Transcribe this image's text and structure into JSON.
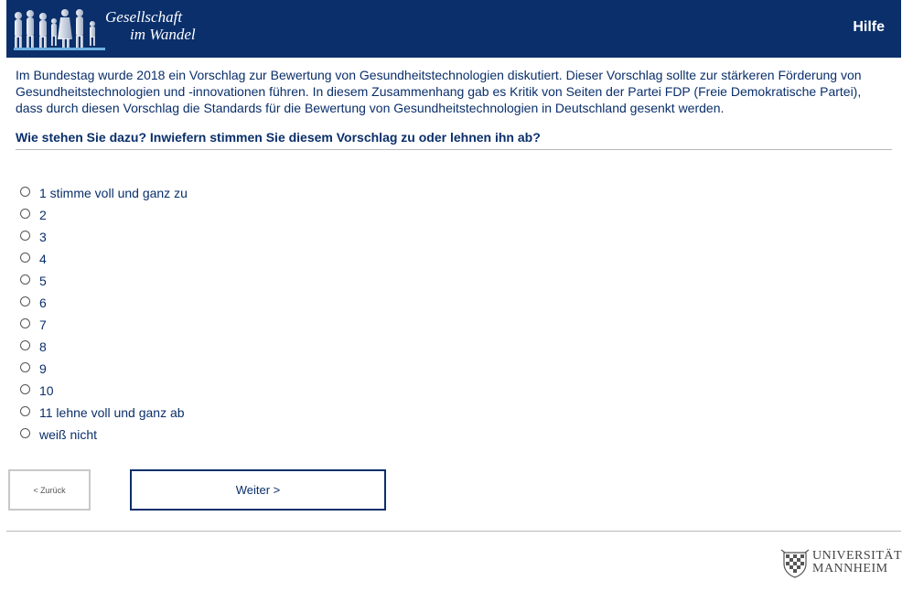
{
  "header": {
    "logo_line1": "Gesellschaft",
    "logo_line2": "im Wandel",
    "help_label": "Hilfe",
    "background": "#0a2f6b"
  },
  "intro_text": "Im Bundestag wurde 2018 ein Vorschlag zur Bewertung von Gesundheitstechnologien diskutiert. Dieser Vorschlag sollte zur stärkeren Förderung von Gesundheitstechnologien und -innovationen führen. In diesem Zusammenhang gab es Kritik von Seiten der Partei FDP (Freie Demokratische Partei), dass durch diesen Vorschlag die Standards für die Bewertung von Gesundheitstechnologien in Deutschland gesenkt werden.",
  "question": "Wie stehen Sie dazu? Inwiefern stimmen Sie diesem Vorschlag zu oder lehnen ihn ab?",
  "options": [
    "1 stimme voll und ganz zu",
    "2",
    "3",
    "4",
    "5",
    "6",
    "7",
    "8",
    "9",
    "10",
    "11 lehne voll und ganz ab",
    "weiß nicht"
  ],
  "nav": {
    "back_label": "< Zurück",
    "next_label": "Weiter >"
  },
  "footer": {
    "uni_line1": "UNIVERSITÄT",
    "uni_line2": "MANNHEIM"
  }
}
